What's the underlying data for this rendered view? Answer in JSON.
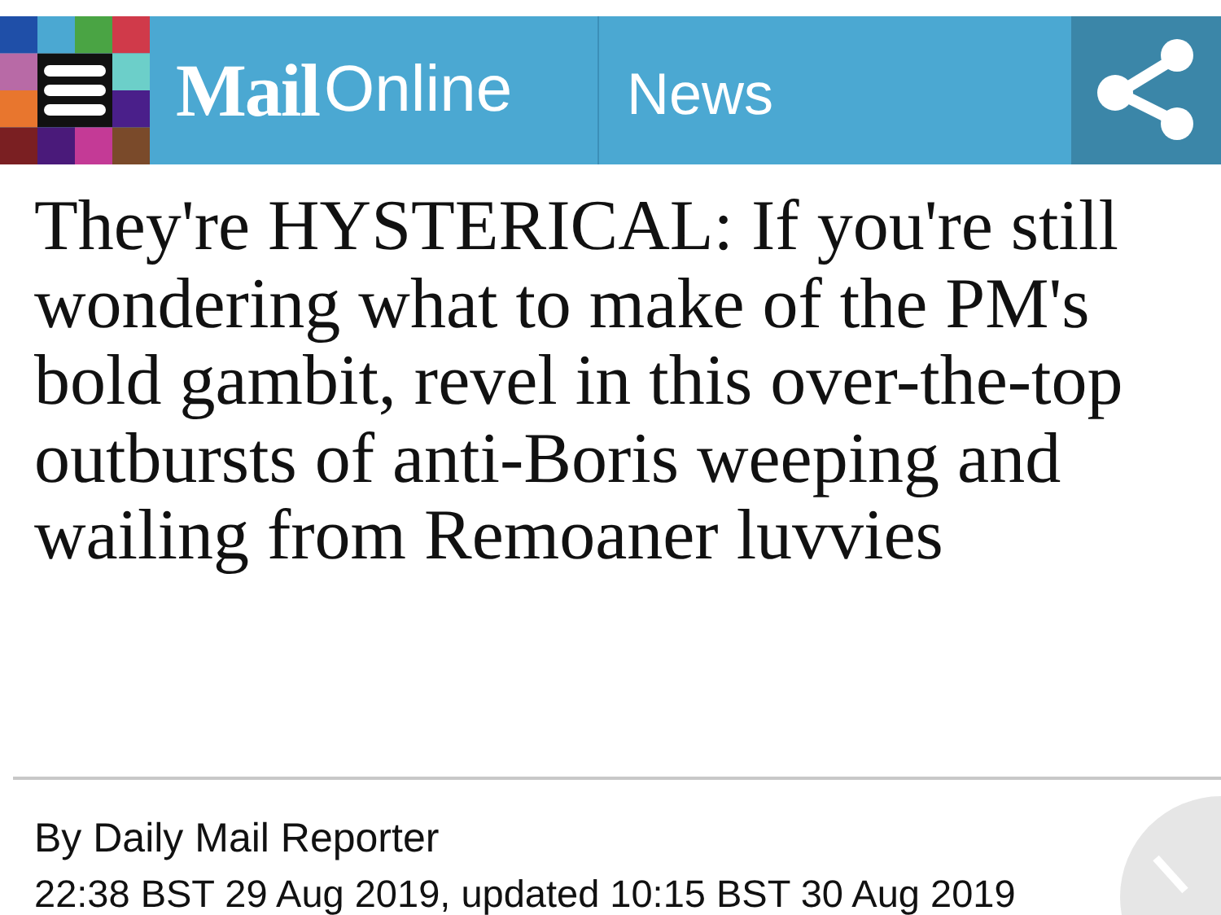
{
  "header": {
    "logo_bold": "Mail",
    "logo_light": "Online",
    "section": "News"
  },
  "headline": "They're HYSTERICAL: If you're still wondering what to make of the PM's bold gambit, revel in this over-the-top outbursts of anti-Boris weeping and wailing from Remoaner luvvies",
  "byline": "By Daily Mail Reporter",
  "dateline": "22:38 BST 29 Aug 2019, updated 10:15 BST 30 Aug 2019"
}
